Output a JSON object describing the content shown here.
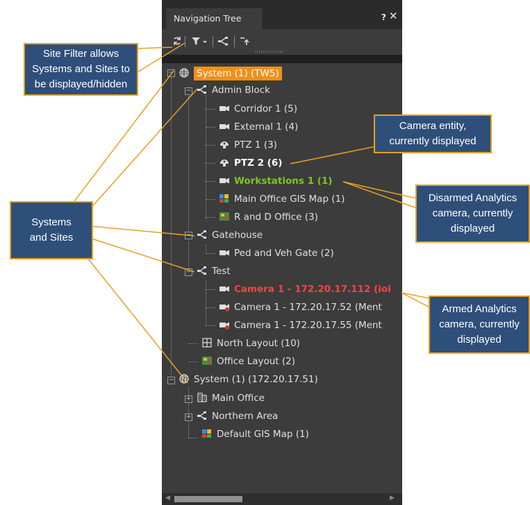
{
  "panel": {
    "title": "Navigation Tree",
    "pin_glyph": "?",
    "close_glyph": "✕",
    "toolbar": {
      "refresh_icon": "refresh-icon",
      "filter_icon": "filter-icon",
      "site_icon": "site-filter-icon",
      "collapse_icon": "collapse-icon"
    }
  },
  "tree": [
    {
      "label": "System (1) (TW5)",
      "icon": "globe-icon",
      "style": "highlight"
    },
    {
      "label": "Admin Block",
      "icon": "site-icon",
      "style": "normal"
    },
    {
      "label": "Corridor 1 (5)",
      "icon": "camera-icon",
      "style": "normal"
    },
    {
      "label": "External 1 (4)",
      "icon": "camera-icon",
      "style": "normal"
    },
    {
      "label": "PTZ 1 (3)",
      "icon": "ptz-camera-icon",
      "style": "normal"
    },
    {
      "label": "PTZ 2 (6)",
      "icon": "ptz-camera-icon",
      "style": "bold"
    },
    {
      "label": "Workstations 1 (1)",
      "icon": "camera-icon",
      "style": "green"
    },
    {
      "label": "Main Office GIS Map (1)",
      "icon": "gis-map-icon",
      "style": "normal"
    },
    {
      "label": "R and D Office (3)",
      "icon": "office-map-icon",
      "style": "normal"
    },
    {
      "label": "Gatehouse",
      "icon": "site-icon",
      "style": "normal"
    },
    {
      "label": "Ped and Veh Gate (2)",
      "icon": "camera-icon",
      "style": "normal"
    },
    {
      "label": "Test",
      "icon": "site-icon",
      "style": "normal"
    },
    {
      "label": "Camera 1 - 172.20.17.112 (ioi",
      "icon": "camera-icon",
      "style": "red"
    },
    {
      "label": "Camera 1 - 172.20.17.52 (Ment",
      "icon": "analytics-camera-icon",
      "style": "normal"
    },
    {
      "label": "Camera 1 - 172.20.17.55 (Ment",
      "icon": "analytics-camera-icon",
      "style": "normal"
    },
    {
      "label": "North Layout (10)",
      "icon": "layout-grid-icon",
      "style": "normal"
    },
    {
      "label": "Office Layout (2)",
      "icon": "office-map-icon",
      "style": "normal"
    },
    {
      "label": "System (1) (172.20.17.51)",
      "icon": "globe-icon",
      "style": "normal"
    },
    {
      "label": "Main Office",
      "icon": "building-icon",
      "style": "normal"
    },
    {
      "label": "Northern Area",
      "icon": "site-icon",
      "style": "normal"
    },
    {
      "label": "Default GIS Map (1)",
      "icon": "gis-map-icon",
      "style": "normal"
    }
  ],
  "expanders": {
    "collapsed": "⊟",
    "expanded": "⊞",
    "minus": "−",
    "plus": "+"
  },
  "callouts": {
    "site_filter": "Site Filter allows Systems and Sites to be displayed/hidden",
    "systems_sites": "Systems and Sites",
    "camera_entity": "Camera entity, currently displayed",
    "disarmed": "Disarmed Analytics camera, currently displayed",
    "armed": "Armed Analytics camera, currently displayed"
  },
  "colors": {
    "panel_bg": "#3c3c3c",
    "highlight": "#f0901c",
    "green_text": "#7ec820",
    "red_text": "#ff4040",
    "callout_bg": "#2e4f7a",
    "callout_border": "#e8a020"
  }
}
